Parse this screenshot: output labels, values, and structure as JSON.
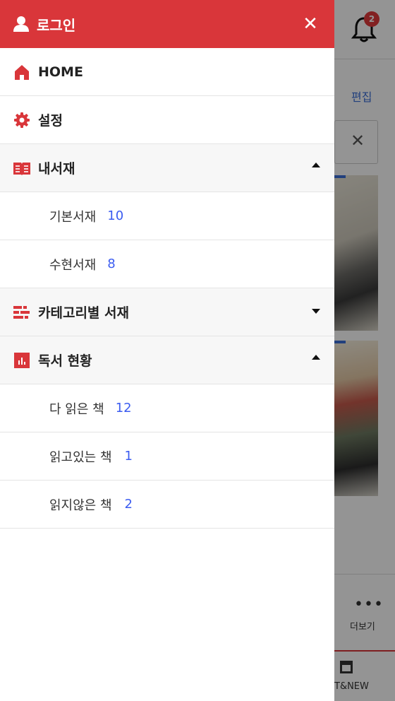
{
  "background": {
    "notification_badge": "2",
    "edit_label": "편집",
    "more_label": "더보기",
    "new_tab_label": "T&NEW"
  },
  "drawer": {
    "login_label": "로그인",
    "menu": {
      "home": "HOME",
      "settings": "설정",
      "my_library": "내서재",
      "category_library": "카테고리별 서재",
      "reading_status": "독서 현황"
    },
    "library_items": [
      {
        "label": "기본서재",
        "count": "10"
      },
      {
        "label": "수현서재",
        "count": "8"
      }
    ],
    "reading_items": [
      {
        "label": "다 읽은 책",
        "count": "12"
      },
      {
        "label": "읽고있는 책",
        "count": "1"
      },
      {
        "label": "읽지않은 책",
        "count": "2"
      }
    ]
  },
  "colors": {
    "accent": "#d9363a",
    "count": "#3b5cf0",
    "section_bg": "#f7f7f7"
  },
  "icons": {
    "header": "user-icon",
    "close": "close-icon",
    "home": "home-icon",
    "settings": "gear-icon",
    "my_library": "book-icon",
    "category": "list-icon",
    "reading_status": "bar-chart-icon",
    "notification": "bell-icon"
  }
}
